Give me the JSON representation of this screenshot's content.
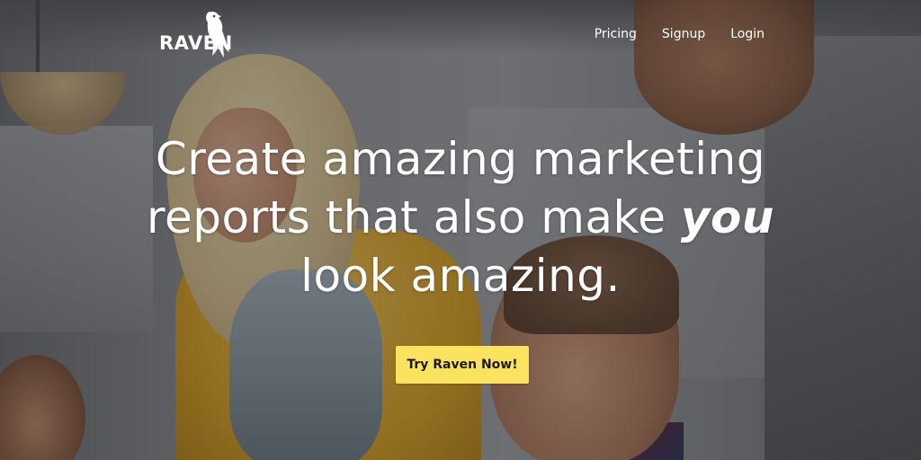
{
  "brand": {
    "logo_text": "RAVEN",
    "logo_icon": "raven-bird-icon"
  },
  "nav": {
    "items": [
      {
        "label": "Pricing"
      },
      {
        "label": "Signup"
      },
      {
        "label": "Login"
      }
    ]
  },
  "hero": {
    "headline_line1": "Create amazing marketing",
    "headline_line2_pre": "reports that also make",
    "headline_line2_em": "you",
    "headline_line3": "look amazing.",
    "cta_label": "Try Raven Now!"
  },
  "colors": {
    "cta_background": "#fbe35f",
    "cta_text": "#1c1c1c",
    "text_on_image": "#ffffff"
  }
}
